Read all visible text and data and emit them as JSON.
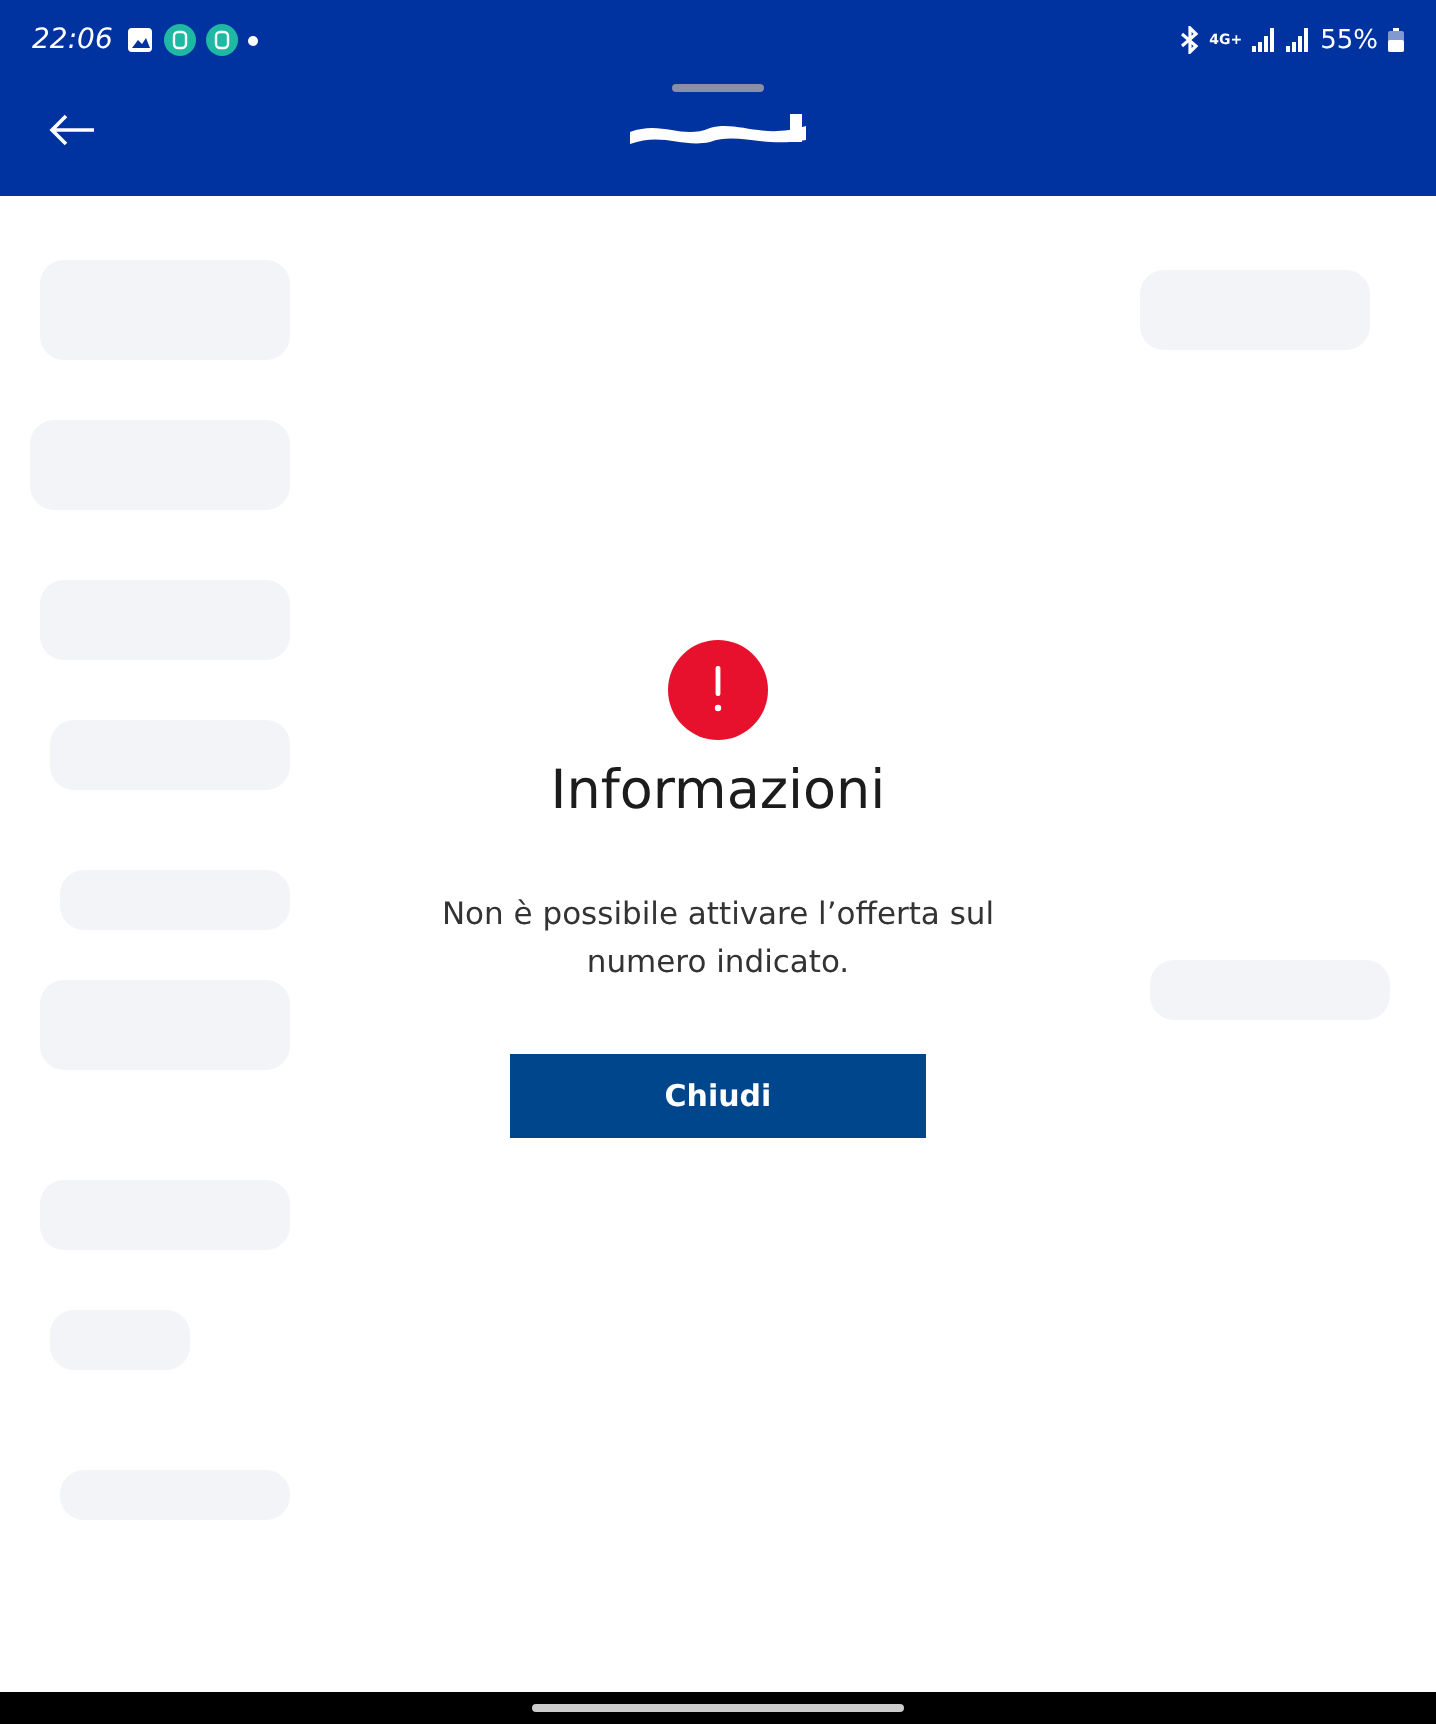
{
  "status_bar": {
    "time": "22:06",
    "network": "4G+",
    "battery": "55%"
  },
  "dialog": {
    "title": "Informazioni",
    "message": "Non è possibile attivare l’offerta sul numero indicato.",
    "button": "Chiudi"
  }
}
